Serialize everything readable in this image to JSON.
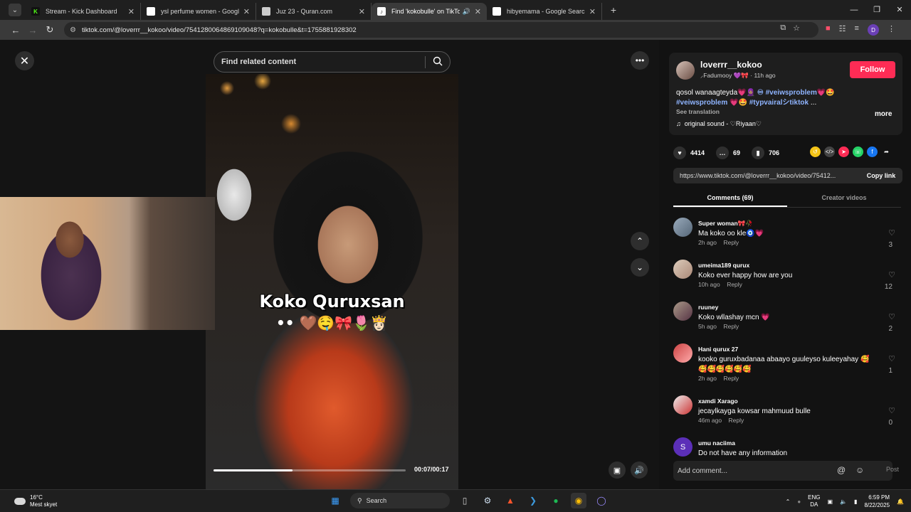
{
  "browser": {
    "tabs": [
      {
        "title": "Stream - Kick Dashboard",
        "favicon": "kick-icon",
        "color": "#53fc18",
        "active": false
      },
      {
        "title": "ysl perfume women - Google S",
        "favicon": "google-icon",
        "color": "#ffffff",
        "active": false
      },
      {
        "title": "Juz 23 - Quran.com",
        "favicon": "quran-icon",
        "color": "#cccccc",
        "active": false
      },
      {
        "title": "Find 'kokobulle' on TikTok |",
        "favicon": "tiktok-icon",
        "color": "#ffffff",
        "active": true
      },
      {
        "title": "hibyemama - Google Search",
        "favicon": "google-icon",
        "color": "#ffffff",
        "active": false
      }
    ],
    "url": "tiktok.com/@loverrr__kokoo/video/7541280064869109048?q=kokobulle&t=1755881928302",
    "profile_initial": "D"
  },
  "player": {
    "search_placeholder": "Find related content",
    "overlay_line1": "Koko Quruxsan",
    "overlay_line2": "•• 🤎🤤🎀🌷👸🏻",
    "time": "00:07/00:17",
    "progress": 0.41
  },
  "post": {
    "username": "loverrr__kokoo",
    "subline": "⸝Fadumooy 💜🎀 · 11h ago",
    "follow_label": "Follow",
    "caption_text": "qosol wanaagteyda💗🧕🏽",
    "caption_tag1": "♾ #veiwsproblem",
    "caption_tag1_tail": "💗🤩",
    "caption_tag2": "#veiwsproblem",
    "caption_tag2_tail": "💗🤩",
    "caption_tag3": "#typvairalシtiktok",
    "caption_ellipsis": "...",
    "more_label": "more",
    "translate_label": "See translation",
    "sound": "original sound - ♡Riyaan♡",
    "likes": "4414",
    "comments_count": "69",
    "saves": "706",
    "share_url": "https://www.tiktok.com/@loverrr__kokoo/video/75412...",
    "copy_label": "Copy link",
    "tab_comments": "Comments (69)",
    "tab_creator": "Creator videos",
    "add_comment_placeholder": "Add comment...",
    "post_label": "Post"
  },
  "comments": [
    {
      "name": "Super woman🎀🥀",
      "text": "Ma koko oo kle🧿💗",
      "time": "2h ago",
      "reply": "Reply",
      "likes": "3"
    },
    {
      "name": "umeima189 qurux",
      "text": "Koko ever happy how are you",
      "time": "10h ago",
      "reply": "Reply",
      "likes": "12"
    },
    {
      "name": "ruuney",
      "text": "Koko wllashay mcn 💗",
      "time": "5h ago",
      "reply": "Reply",
      "likes": "2"
    },
    {
      "name": "Hani qurux 27",
      "text": "kooko guruxbadanaa abaayo guuleyso kuleeyahay 🥰🥰🥰🥰🥰🥰🥰",
      "time": "2h ago",
      "reply": "Reply",
      "likes": "1"
    },
    {
      "name": "xamdi Xarago",
      "text": "jecaylkayga kowsar mahmuud bulle",
      "time": "46m ago",
      "reply": "Reply",
      "likes": "0"
    },
    {
      "name": "umu naciima",
      "text": "Do not have any information",
      "time": "",
      "reply": "",
      "likes": ""
    }
  ],
  "taskbar": {
    "temp": "16°C",
    "weather": "Mest skyet",
    "search_label": "Search",
    "lang1": "ENG",
    "lang2": "DA",
    "time": "6:59 PM",
    "date": "8/22/2025"
  }
}
